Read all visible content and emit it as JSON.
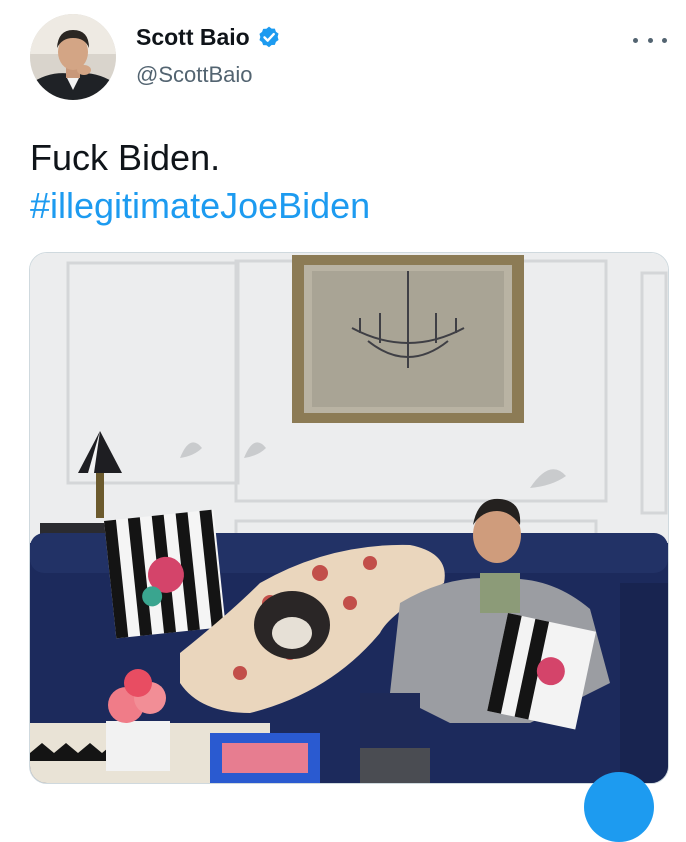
{
  "author": {
    "display_name": "Scott Baio",
    "handle": "@ScottBaio",
    "verified": true
  },
  "tweet": {
    "text": "Fuck Biden.",
    "hashtag": "#illegitimateJoeBiden"
  },
  "media": {
    "kind": "photo"
  },
  "icons": {
    "verified": "verified-badge-icon",
    "more": "more-options-icon",
    "compose": "compose-button"
  },
  "colors": {
    "hashtag": "#1d9bf0",
    "verified": "#1d9bf0",
    "secondary_text": "#536471"
  }
}
